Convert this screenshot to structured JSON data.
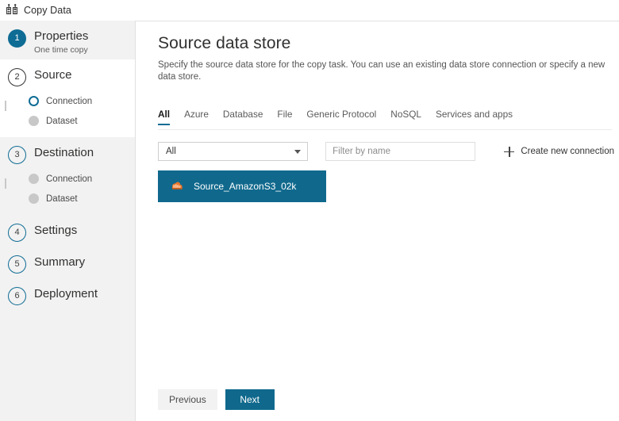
{
  "app": {
    "title": "Copy Data",
    "title_icon": "copy-data-icon"
  },
  "sidebar": {
    "steps": [
      {
        "number": "1",
        "label": "Properties",
        "sublabel": "One time copy",
        "state": "completed",
        "substeps": []
      },
      {
        "number": "2",
        "label": "Source",
        "sublabel": "",
        "state": "active",
        "substeps": [
          {
            "label": "Connection",
            "state": "current"
          },
          {
            "label": "Dataset",
            "state": "pending"
          }
        ]
      },
      {
        "number": "3",
        "label": "Destination",
        "sublabel": "",
        "state": "pending",
        "substeps": [
          {
            "label": "Connection",
            "state": "pending"
          },
          {
            "label": "Dataset",
            "state": "pending"
          }
        ]
      },
      {
        "number": "4",
        "label": "Settings",
        "sublabel": "",
        "state": "pending",
        "substeps": []
      },
      {
        "number": "5",
        "label": "Summary",
        "sublabel": "",
        "state": "pending",
        "substeps": []
      },
      {
        "number": "6",
        "label": "Deployment",
        "sublabel": "",
        "state": "pending",
        "substeps": []
      }
    ]
  },
  "main": {
    "title": "Source data store",
    "subtitle": "Specify the source data store for the copy task. You can use an existing data store connection or specify a new data store.",
    "tabs": [
      {
        "label": "All",
        "selected": true
      },
      {
        "label": "Azure",
        "selected": false
      },
      {
        "label": "Database",
        "selected": false
      },
      {
        "label": "File",
        "selected": false
      },
      {
        "label": "Generic Protocol",
        "selected": false
      },
      {
        "label": "NoSQL",
        "selected": false
      },
      {
        "label": "Services and apps",
        "selected": false
      }
    ],
    "filters": {
      "category_value": "All",
      "search_placeholder": "Filter by name",
      "search_value": "",
      "create_connection_label": "Create new connection"
    },
    "connections": [
      {
        "name": "Source_AmazonS3_02k",
        "icon": "amazon-s3-icon",
        "selected": true
      }
    ]
  },
  "footer": {
    "previous_label": "Previous",
    "next_label": "Next"
  },
  "colors": {
    "accent": "#10698d",
    "sidebar_bg": "#f2f2f2",
    "card_selected": "#10698d",
    "s3_orange": "#e8762d"
  }
}
